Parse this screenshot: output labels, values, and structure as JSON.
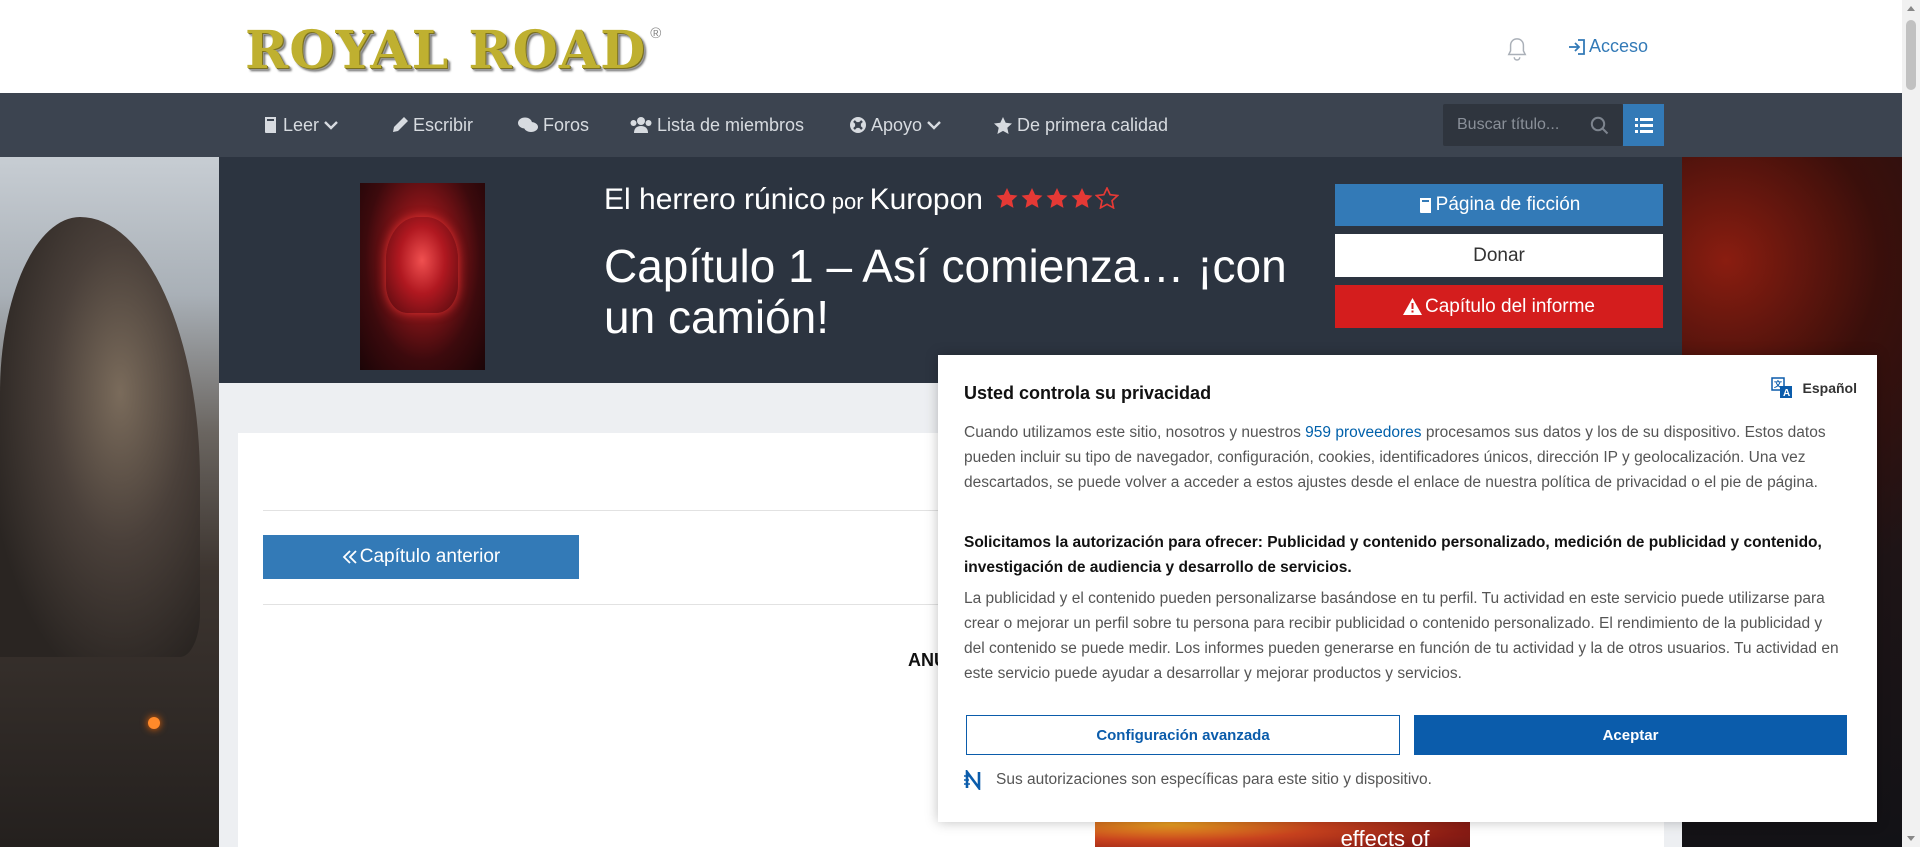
{
  "site": {
    "logo_text": "ROYAL ROAD",
    "logo_mark": "®",
    "login_label": "Acceso"
  },
  "nav": {
    "items": [
      {
        "label": "Leer",
        "icon": "book-icon",
        "dropdown": true
      },
      {
        "label": "Escribir",
        "icon": "pencil-icon",
        "dropdown": false
      },
      {
        "label": "Foros",
        "icon": "comments-icon",
        "dropdown": false
      },
      {
        "label": "Lista de miembros",
        "icon": "users-icon",
        "dropdown": false
      },
      {
        "label": "Apoyo",
        "icon": "support-icon",
        "dropdown": true
      },
      {
        "label": "De primera calidad",
        "icon": "star-icon",
        "dropdown": false
      }
    ],
    "search_placeholder": "Buscar título..."
  },
  "fiction": {
    "title": "El herrero rúnico",
    "by": "por",
    "author": "Kuropon",
    "rating": 4,
    "rating_max": 5,
    "chapter_title": "Capítulo 1 – Así comienza… ¡con un camión!",
    "buttons": {
      "fiction_page": "Página de ficción",
      "donate": "Donar",
      "report": "Capítulo del informe"
    }
  },
  "chapter_nav": {
    "prev_label": "Capítulo anterior"
  },
  "content": {
    "announcement_partial": "ANU",
    "ad_text": "kness but side-effects of"
  },
  "consent": {
    "title": "Usted controla su privacidad",
    "language": "Español",
    "para1_before": "Cuando utilizamos este sitio, nosotros y nuestros ",
    "para1_link": "959 proveedores",
    "para1_after": " procesamos sus datos y los de su dispositivo. Estos datos pueden incluir su tipo de navegador, configuración, cookies, identificadores únicos, dirección IP y geolocalización. Una vez descartados, se puede volver a acceder a estos ajustes desde el enlace de nuestra política de privacidad o el pie de página.",
    "para2": "Solicitamos la autorización para ofrecer: Publicidad y contenido personalizado, medición de publicidad y contenido, investigación de audiencia y desarrollo de servicios.",
    "para3": "La publicidad y el contenido pueden personalizarse basándose en tu perfil. Tu actividad en este servicio puede utilizarse para crear o mejorar un perfil sobre tu persona para recibir publicidad o contenido personalizado. El rendimiento de la publicidad y del contenido se puede medir. Los informes pueden generarse en función de tu actividad y la de otros usuarios. Tu actividad en este servicio puede ayudar a desarrollar y mejorar productos y servicios.",
    "advanced_label": "Configuración avanzada",
    "accept_label": "Aceptar",
    "footer": "Sus autorizaciones son específicas para este sitio y dispositivo."
  },
  "colors": {
    "nav_bg": "#3c4450",
    "header_bg": "#2c3440",
    "primary": "#337ab7",
    "danger": "#d41d1d",
    "consent_primary": "#0b5cab",
    "star": "#e53935"
  }
}
